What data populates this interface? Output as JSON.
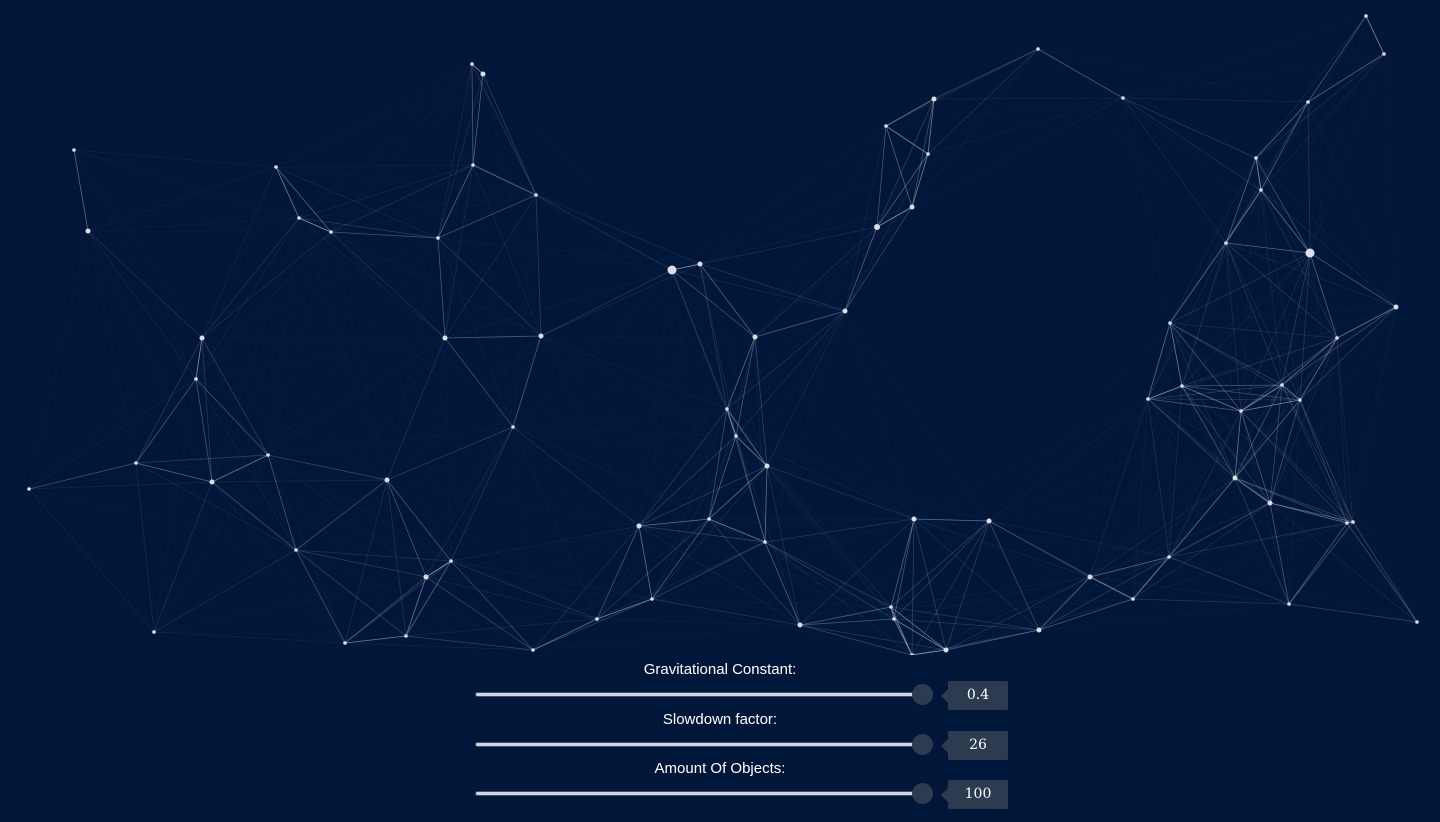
{
  "page": {
    "background_color": "#00173a",
    "node_color": "#d9dee8",
    "edge_color": "#aab4c8"
  },
  "sliders": [
    {
      "id": "gravitational-constant",
      "label": "Gravitational Constant:",
      "value": "0.4",
      "fill_fraction": 0.98
    },
    {
      "id": "slowdown-factor",
      "label": "Slowdown factor:",
      "value": "26",
      "fill_fraction": 0.98
    },
    {
      "id": "amount-of-objects",
      "label": "Amount Of Objects:",
      "value": "100",
      "fill_fraction": 0.98
    }
  ]
}
